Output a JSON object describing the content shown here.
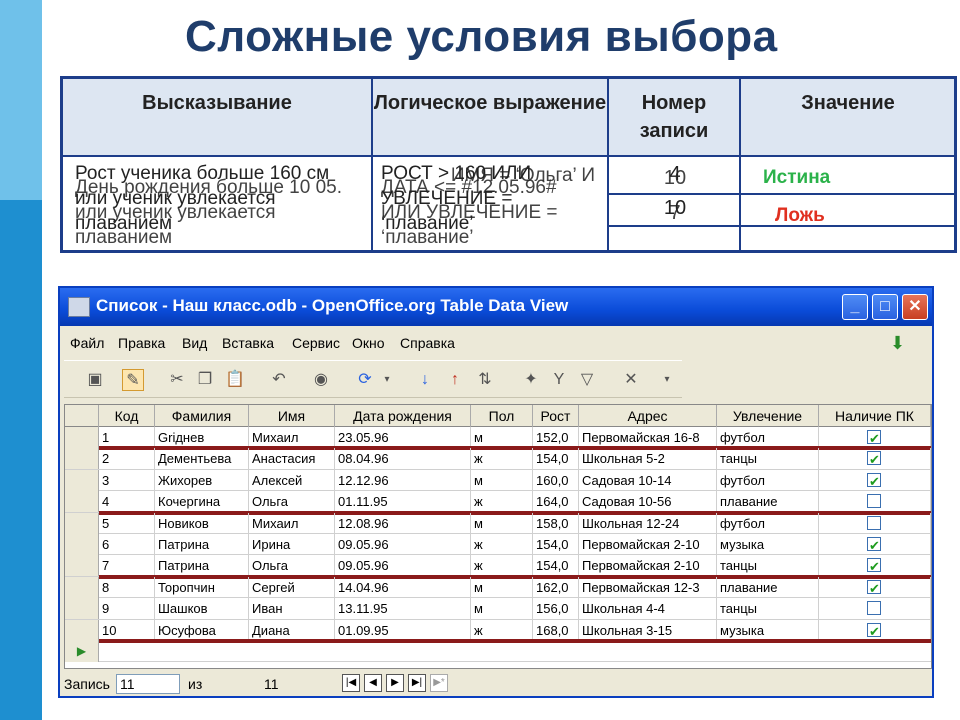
{
  "slide": {
    "title": "Сложные условия выбора"
  },
  "logic_table": {
    "headers": [
      "Высказывание",
      "Логическое выражение",
      "Номер записи",
      "Значение"
    ],
    "statements": [
      "Рост ученика больше 160 см или ученик увлекается плаванием",
      "День рождения больше 10 05. или ученик увлекается плаванием"
    ],
    "expressions": [
      "РОСТ > 160 ИЛИ УВЛЕЧЕНИЕ = ‘плавание’",
      "ДАТА <= #12.05.96# ИЛИ УВЛЕЧЕНИЕ = ‘плавание’",
      "ИМЯ = ‘Ольга’ И"
    ],
    "record_numbers": [
      "4",
      "10",
      "10",
      "7"
    ],
    "values": {
      "true": "Истина",
      "false": "Ложь"
    }
  },
  "window": {
    "title": "Список - Наш класс.odb - OpenOffice.org Table Data View",
    "menu": [
      "Файл",
      "Правка",
      "Вид",
      "Вставка",
      "Сервис",
      "Окно",
      "Справка"
    ],
    "toolbar_icons": [
      "save-icon",
      "edit-icon",
      "cut-icon",
      "copy-icon",
      "paste-icon",
      "undo-icon",
      "find-icon",
      "refresh-icon",
      "sort-ascending-icon",
      "sort-descending-icon",
      "sort-icon",
      "autofilter-icon",
      "standard-filter-icon",
      "filter-icon",
      "remove-filter-icon"
    ],
    "columns": [
      "Код",
      "Фамилия",
      "Имя",
      "Дата рождения",
      "Пол",
      "Рост",
      "Адрес",
      "Увлечение",
      "Наличие ПК"
    ],
    "rows": [
      {
        "id": "1",
        "surname": "Griднев",
        "name": "Михаил",
        "date": "23.05.96",
        "sex": "м",
        "height": "152,0",
        "address": "Первомайская 16-8",
        "hobby": "футбол",
        "pc": true
      },
      {
        "id": "2",
        "surname": "Дементьева",
        "name": "Анастасия",
        "date": "08.04.96",
        "sex": "ж",
        "height": "154,0",
        "address": "Школьная 5-2",
        "hobby": "танцы",
        "pc": true
      },
      {
        "id": "3",
        "surname": "Жихорев",
        "name": "Алексей",
        "date": "12.12.96",
        "sex": "м",
        "height": "160,0",
        "address": "Садовая 10-14",
        "hobby": "футбол",
        "pc": true
      },
      {
        "id": "4",
        "surname": "Кочергина",
        "name": "Ольга",
        "date": "01.11.95",
        "sex": "ж",
        "height": "164,0",
        "address": "Садовая 10-56",
        "hobby": "плавание",
        "pc": false
      },
      {
        "id": "5",
        "surname": "Новиков",
        "name": "Михаил",
        "date": "12.08.96",
        "sex": "м",
        "height": "158,0",
        "address": "Школьная 12-24",
        "hobby": "футбол",
        "pc": false
      },
      {
        "id": "6",
        "surname": "Патрина",
        "name": "Ирина",
        "date": "09.05.96",
        "sex": "ж",
        "height": "154,0",
        "address": "Первомайская 2-10",
        "hobby": "музыка",
        "pc": true
      },
      {
        "id": "7",
        "surname": "Патрина",
        "name": "Ольга",
        "date": "09.05.96",
        "sex": "ж",
        "height": "154,0",
        "address": "Первомайская 2-10",
        "hobby": "танцы",
        "pc": true
      },
      {
        "id": "8",
        "surname": "Торопчин",
        "name": "Сергей",
        "date": "14.04.96",
        "sex": "м",
        "height": "162,0",
        "address": "Первомайская 12-3",
        "hobby": "плавание",
        "pc": true
      },
      {
        "id": "9",
        "surname": "Шашков",
        "name": "Иван",
        "date": "13.11.95",
        "sex": "м",
        "height": "156,0",
        "address": "Школьная 4-4",
        "hobby": "танцы",
        "pc": false
      },
      {
        "id": "10",
        "surname": "Юсуфова",
        "name": "Диана",
        "date": "01.09.95",
        "sex": "ж",
        "height": "168,0",
        "address": "Школьная 3-15",
        "hobby": "музыка",
        "pc": true
      }
    ],
    "status": {
      "record_label": "Запись",
      "record_value": "11",
      "of_label": "из",
      "total": "11"
    }
  }
}
